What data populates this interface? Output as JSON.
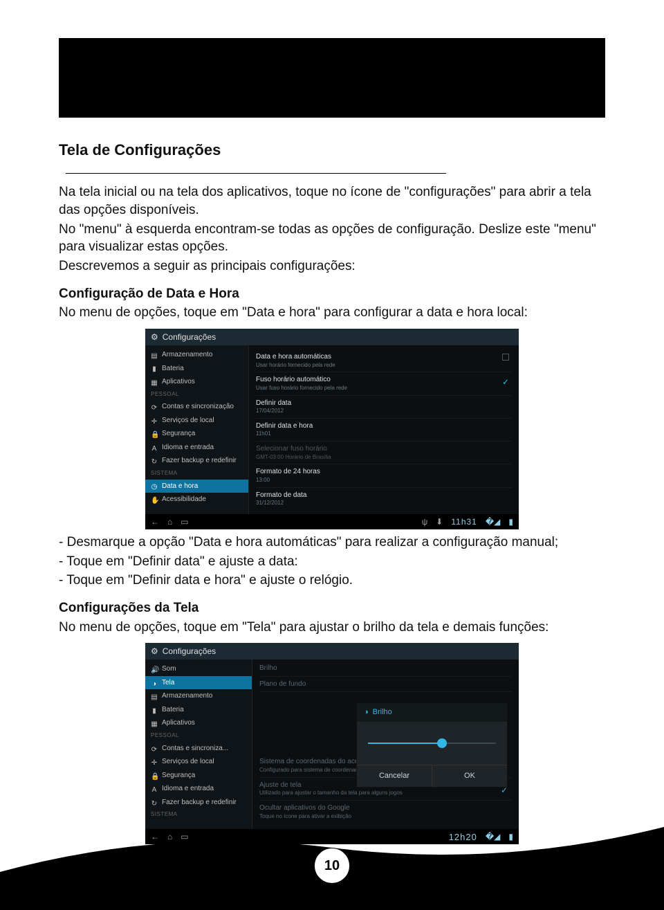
{
  "page_number": "10",
  "section_title": "Tela de Configurações",
  "intro": {
    "p1": "Na tela inicial ou na tela dos aplicativos, toque no ícone de \"configurações\" para abrir a tela das opções disponíveis.",
    "p2": "No \"menu\" à esquerda encontram-se todas as opções de configuração. Deslize este \"menu\" para visualizar estas opções.",
    "p3": "Descrevemos a seguir as principais configurações:"
  },
  "datahora": {
    "heading": "Configuração de Data e Hora",
    "desc": "No menu de opções, toque em \"Data e hora\" para configurar a data e hora local:"
  },
  "bullets": {
    "b1": "- Desmarque a opção \"Data e hora automáticas\" para realizar a configuração manual;",
    "b2": "- Toque em \"Definir data\" e ajuste a data:",
    "b3": "- Toque em \"Definir data e hora\" e ajuste o relógio."
  },
  "tela": {
    "heading": "Configurações da Tela",
    "desc": "No menu de opções, toque em \"Tela\" para ajustar o brilho da tela e demais funções:"
  },
  "shot1": {
    "title": "Configurações",
    "side_head": "PESSOAL",
    "side_head2": "SISTEMA",
    "side": {
      "armazenamento": "Armazenamento",
      "bateria": "Bateria",
      "aplicativos": "Aplicativos",
      "contas": "Contas e sincronização",
      "local": "Serviços de local",
      "seguranca": "Segurança",
      "idioma": "Idioma e entrada",
      "backup": "Fazer backup e redefinir",
      "datahora": "Data e hora",
      "acess": "Acessibilidade"
    },
    "opts": {
      "auto": {
        "lbl": "Data e hora automáticas",
        "sub": "Usar horário fornecido pela rede"
      },
      "fuso_auto": {
        "lbl": "Fuso horário automático",
        "sub": "Usar fuso horário fornecido pela rede"
      },
      "def_data": {
        "lbl": "Definir data",
        "sub": "17/04/2012"
      },
      "def_hora": {
        "lbl": "Definir data e hora",
        "sub": "11h01"
      },
      "sel_fuso": {
        "lbl": "Selecionar fuso horário",
        "sub": "GMT-03:00 Horário de Brasília"
      },
      "f24": {
        "lbl": "Formato de 24 horas",
        "sub": "13:00"
      },
      "fdata": {
        "lbl": "Formato de data",
        "sub": "31/12/2012"
      }
    },
    "clock": "11h31"
  },
  "shot2": {
    "title": "Configurações",
    "side_head": "PESSOAL",
    "side_head2": "SISTEMA",
    "side": {
      "som": "Som",
      "tela": "Tela",
      "armazenamento": "Armazenamento",
      "bateria": "Bateria",
      "aplicativos": "Aplicativos",
      "contas": "Contas e sincroniza...",
      "local": "Serviços de local",
      "seguranca": "Segurança",
      "idioma": "Idioma e entrada",
      "backup": "Fazer backup e redefinir"
    },
    "opts": {
      "brilho_top": "Brilho",
      "plano": "Plano de fundo",
      "accel": {
        "lbl": "Sistema de coordenadas do acelerômetro",
        "sub": "Configurado para sistema de coordenadas padrão"
      },
      "ajuste": {
        "lbl": "Ajuste de tela",
        "sub": "Utilizado para ajustar o tamanho da tela para alguns jogos"
      },
      "ocultar": {
        "lbl": "Ocultar aplicativos do Google",
        "sub": "Toque no ícone para ativar a exibição"
      }
    },
    "dialog": {
      "title": "Brilho",
      "cancel": "Cancelar",
      "ok": "OK"
    },
    "clock": "12h20"
  }
}
